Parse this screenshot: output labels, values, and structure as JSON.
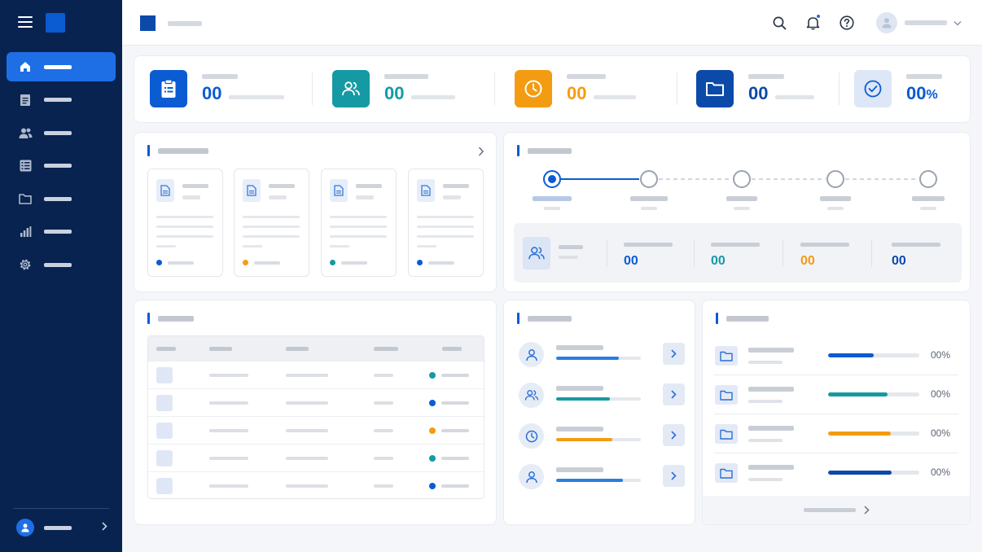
{
  "colors": {
    "primary": "#0b5bd3",
    "teal": "#159aa3",
    "orange": "#f39c12",
    "dark_blue": "#0b4aa8",
    "sidebar_bg": "#08234f",
    "active_nav": "#1e6fe6"
  },
  "sidebar": {
    "items": [
      {
        "icon": "home-icon",
        "active": true
      },
      {
        "icon": "document-icon"
      },
      {
        "icon": "users-icon"
      },
      {
        "icon": "list-icon"
      },
      {
        "icon": "folder-icon"
      },
      {
        "icon": "bar-chart-icon"
      },
      {
        "icon": "gear-icon"
      }
    ],
    "user": {
      "icon": "user-icon"
    }
  },
  "header": {
    "icons": [
      "search-icon",
      "bell-icon",
      "help-icon"
    ],
    "notification_dot": true
  },
  "stats": [
    {
      "icon": "clipboard-icon",
      "value": "00",
      "color": "#0b5bd3"
    },
    {
      "icon": "users-icon",
      "value": "00",
      "color": "#159aa3"
    },
    {
      "icon": "clock-icon",
      "value": "00",
      "color": "#f39c12"
    },
    {
      "icon": "folder-icon",
      "value": "00",
      "color": "#0b4aa8"
    },
    {
      "icon": "check-circle-icon",
      "value": "00",
      "unit": "%",
      "color": "#0b5bd3"
    }
  ],
  "documents": [
    {
      "status_color": "#0b5bd3"
    },
    {
      "status_color": "#f39c12"
    },
    {
      "status_color": "#159aa3"
    },
    {
      "status_color": "#0b5bd3"
    }
  ],
  "progress": {
    "steps": 5,
    "current_step": 1,
    "summary": [
      {
        "value": "00",
        "color": "#0b5bd3"
      },
      {
        "value": "00",
        "color": "#159aa3"
      },
      {
        "value": "00",
        "color": "#f39c12"
      },
      {
        "value": "00",
        "color": "#0b4aa8"
      }
    ]
  },
  "table": {
    "rows": [
      {
        "status_color": "#159aa3"
      },
      {
        "status_color": "#0b5bd3"
      },
      {
        "status_color": "#f39c12"
      },
      {
        "status_color": "#159aa3"
      },
      {
        "status_color": "#0b5bd3"
      }
    ]
  },
  "team": [
    {
      "icon": "user-icon",
      "progress": 0.74,
      "color": "#2a7de1"
    },
    {
      "icon": "users-icon",
      "progress": 0.63,
      "color": "#159aa3"
    },
    {
      "icon": "clock-icon",
      "progress": 0.66,
      "color": "#f39c12"
    },
    {
      "icon": "user-icon",
      "progress": 0.79,
      "color": "#2a7de1"
    }
  ],
  "storage": [
    {
      "icon": "folder-icon",
      "progress": 0.5,
      "color": "#0b5bd3",
      "percent": "00%"
    },
    {
      "icon": "folder-icon",
      "progress": 0.65,
      "color": "#159aa3",
      "percent": "00%"
    },
    {
      "icon": "folder-icon",
      "progress": 0.69,
      "color": "#f39c12",
      "percent": "00%"
    },
    {
      "icon": "folder-icon",
      "progress": 0.7,
      "color": "#0b4aa8",
      "percent": "00%"
    }
  ]
}
